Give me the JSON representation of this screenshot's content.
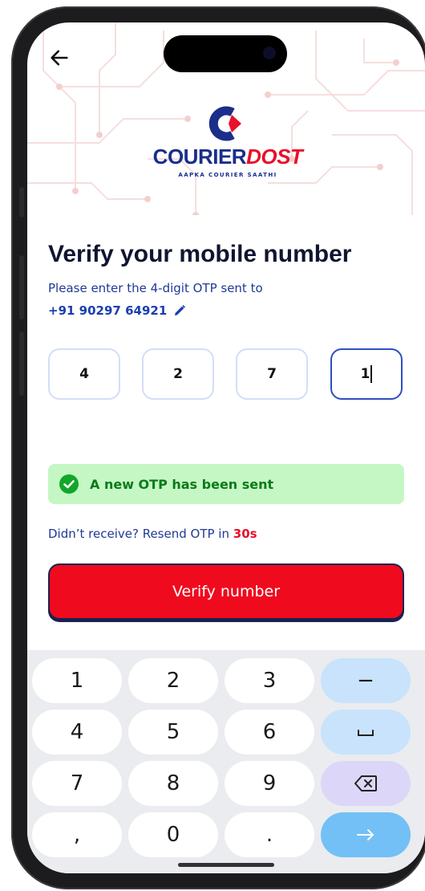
{
  "brand": {
    "name_part1": "COURIER",
    "name_part2": "DOST",
    "tagline": "AAPKA COURIER SAATHI",
    "primary_color": "#1a2e8a",
    "accent_color": "#e8102a"
  },
  "header": {
    "back_icon": "arrow-left-icon"
  },
  "main": {
    "title": "Verify your mobile number",
    "subtitle": "Please enter the 4-digit OTP sent to",
    "phone_number": "+91 90297 64921",
    "edit_icon": "pencil-icon",
    "otp_digits": [
      "4",
      "2",
      "7",
      "1"
    ],
    "active_otp_index": 3,
    "banner": {
      "icon": "check-circle-icon",
      "text": "A new OTP has been sent",
      "color": "#0a7a1a"
    },
    "resend_text": "Didn’t receive? Resend OTP in",
    "resend_timer": "30s",
    "verify_button": "Verify number"
  },
  "keyboard": {
    "rows": [
      [
        "1",
        "2",
        "3",
        "-"
      ],
      [
        "4",
        "5",
        "6",
        "space-icon"
      ],
      [
        "7",
        "8",
        "9",
        "backspace-icon"
      ],
      [
        ",",
        "0",
        ".",
        "arrow-right-icon"
      ]
    ],
    "key_labels": {
      "k1": "1",
      "k2": "2",
      "k3": "3",
      "dash": "−",
      "k4": "4",
      "k5": "5",
      "k6": "6",
      "k7": "7",
      "k8": "8",
      "k9": "9",
      "comma": ",",
      "k0": "0",
      "period": "."
    }
  }
}
